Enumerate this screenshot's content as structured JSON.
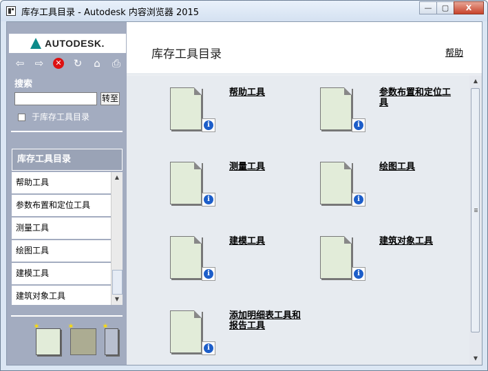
{
  "window": {
    "title": "库存工具目录 - Autodesk 内容浏览器 2015",
    "minimize": "—",
    "maximize": "▢",
    "close": "X"
  },
  "sidebar": {
    "logo_text": "AUTODESK.",
    "toolbar": [
      {
        "name": "back-icon",
        "glyph": "⇦"
      },
      {
        "name": "forward-icon",
        "glyph": "⇨"
      },
      {
        "name": "stop-icon",
        "glyph": "✕"
      },
      {
        "name": "refresh-icon",
        "glyph": "↻"
      },
      {
        "name": "home-icon",
        "glyph": "⌂"
      },
      {
        "name": "print-icon",
        "glyph": "⎙"
      }
    ],
    "search_label": "搜索",
    "search_value": "",
    "goto_label": "转至",
    "scope_label": "于库存工具目录",
    "nav_header": "库存工具目录",
    "nav_items": [
      "帮助工具",
      "参数布置和定位工具",
      "测量工具",
      "绘图工具",
      "建模工具",
      "建筑对象工具"
    ]
  },
  "main": {
    "title": "库存工具目录",
    "help_link": "帮助",
    "tiles": [
      {
        "label": "帮助工具"
      },
      {
        "label": "参数布置和定位工具"
      },
      {
        "label": "测量工具"
      },
      {
        "label": "绘图工具"
      },
      {
        "label": "建模工具"
      },
      {
        "label": "建筑对象工具"
      },
      {
        "label": "添加明细表工具和报告工具"
      }
    ],
    "info_glyph": "i"
  }
}
